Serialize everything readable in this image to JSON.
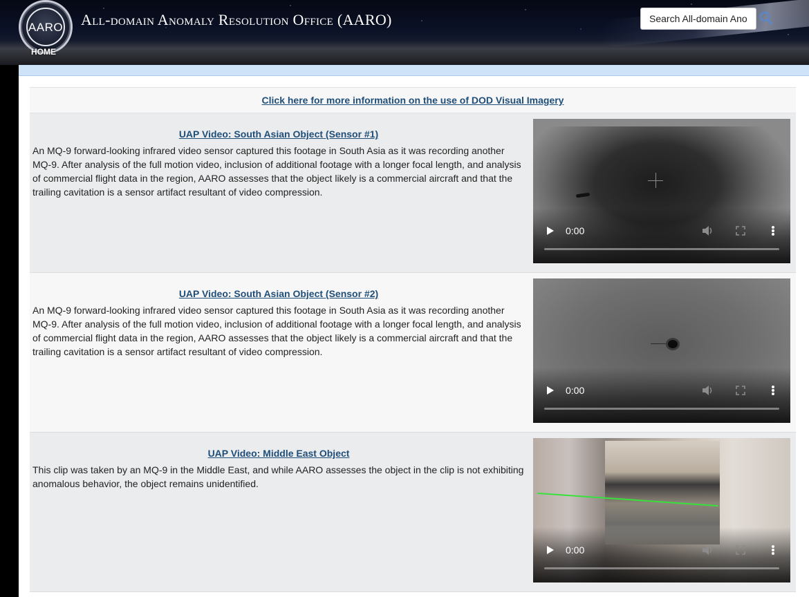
{
  "header": {
    "seal_text": "AARO",
    "site_title": "All-domain Anomaly Resolution Office (AARO)",
    "home_label": "HOME",
    "search_placeholder": "Search All-domain Anomaly Resolution Office (AARO)"
  },
  "info_link": "Click here for more information on the use of DOD Visual Imagery",
  "videos": [
    {
      "title": "UAP Video: South Asian Object (Sensor #1)",
      "description": "An MQ-9 forward-looking infrared video sensor captured this footage in South Asia as it was recording another MQ-9. After analysis of the full motion video, inclusion of additional footage with a longer focal length, and analysis of commercial flight data in the region, AARO assesses that the object likely is a commercial aircraft and that the trailing cavitation is a sensor artifact resultant of video compression.",
      "time": "0:00"
    },
    {
      "title": "UAP Video: South Asian Object (Sensor #2)",
      "description": "An MQ-9 forward-looking infrared video sensor captured this footage in South Asia as it was recording another MQ-9. After analysis of the full motion video, inclusion of additional footage with a longer focal length, and analysis of commercial flight data in the region, AARO assesses that the object likely is a commercial aircraft and that the trailing cavitation is a sensor artifact resultant of video compression.",
      "time": "0:00"
    },
    {
      "title": "UAP Video: Middle East Object",
      "description": "This clip was taken by an MQ-9 in the Middle East, and while AARO assesses the object in the clip is not exhibiting anomalous behavior, the object remains unidentified.",
      "time": "0:00"
    }
  ],
  "colors": {
    "link": "#1f4e79",
    "band": "#cfe3f8",
    "row_alt": "#ebeced"
  },
  "icons": [
    "seal-icon",
    "search-icon",
    "play-icon",
    "volume-icon",
    "fullscreen-icon",
    "more-options-icon"
  ]
}
